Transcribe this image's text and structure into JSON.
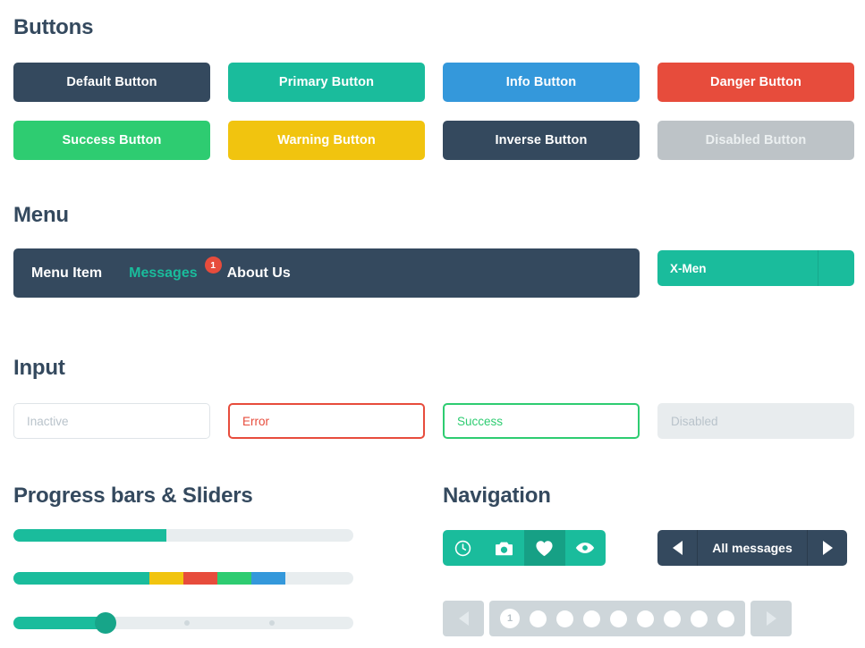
{
  "sections": {
    "buttons_title": "Buttons",
    "menu_title": "Menu",
    "input_title": "Input",
    "progress_title": "Progress bars & Sliders",
    "navigation_title": "Navigation"
  },
  "buttons": [
    {
      "label": "Default Button",
      "variant": "default",
      "color": "#34495e"
    },
    {
      "label": "Primary Button",
      "variant": "primary",
      "color": "#1abc9c"
    },
    {
      "label": "Info Button",
      "variant": "info",
      "color": "#3498db"
    },
    {
      "label": "Danger Button",
      "variant": "danger",
      "color": "#e74c3c"
    },
    {
      "label": "Success Button",
      "variant": "success",
      "color": "#2ecc71"
    },
    {
      "label": "Warning Button",
      "variant": "warning",
      "color": "#f1c40f"
    },
    {
      "label": "Inverse Button",
      "variant": "inverse",
      "color": "#34495e"
    },
    {
      "label": "Disabled Button",
      "variant": "disabled",
      "color": "#bdc3c7"
    }
  ],
  "menu": {
    "items": [
      {
        "label": "Menu Item",
        "active": false
      },
      {
        "label": "Messages",
        "active": true
      },
      {
        "label": "About Us",
        "active": false
      }
    ],
    "badge_count": "1",
    "badge_color": "#e74c3c"
  },
  "select": {
    "value": "X-Men",
    "color": "#1abc9c"
  },
  "inputs": [
    {
      "name": "inactive",
      "value": "",
      "placeholder": "Inactive",
      "state": "inactive"
    },
    {
      "name": "error",
      "value": "",
      "placeholder": "Error",
      "state": "error"
    },
    {
      "name": "success",
      "value": "",
      "placeholder": "Success",
      "state": "success"
    },
    {
      "name": "disabled",
      "value": "",
      "placeholder": "Disabled",
      "state": "disabled"
    }
  ],
  "progress": {
    "simple": {
      "percent": 45,
      "color": "#1abc9c"
    },
    "stacked": {
      "segments": [
        {
          "name": "primary",
          "percent": 40,
          "color": "#1abc9c"
        },
        {
          "name": "warning",
          "percent": 10,
          "color": "#f1c40f"
        },
        {
          "name": "danger",
          "percent": 10,
          "color": "#e74c3c"
        },
        {
          "name": "success",
          "percent": 10,
          "color": "#2ecc71"
        },
        {
          "name": "info",
          "percent": 10,
          "color": "#3498db"
        }
      ]
    },
    "slider": {
      "value": 27,
      "fill_color": "#1abc9c",
      "thumb_color": "#17a589",
      "ticks": [
        51,
        76
      ]
    }
  },
  "navigation": {
    "icon_buttons": [
      {
        "icon": "clock-icon",
        "active": false
      },
      {
        "icon": "camera-icon",
        "active": false
      },
      {
        "icon": "heart-icon",
        "active": true
      },
      {
        "icon": "eye-icon",
        "active": false
      }
    ],
    "pager": {
      "prev_icon": "triangle-left-icon",
      "label": "All messages",
      "next_icon": "triangle-right-icon"
    },
    "pagination": {
      "prev_icon": "triangle-left-icon",
      "next_icon": "triangle-right-icon",
      "pages": [
        "1",
        "",
        "",
        "",
        "",
        "",
        "",
        "",
        ""
      ],
      "current_page": "1"
    }
  }
}
